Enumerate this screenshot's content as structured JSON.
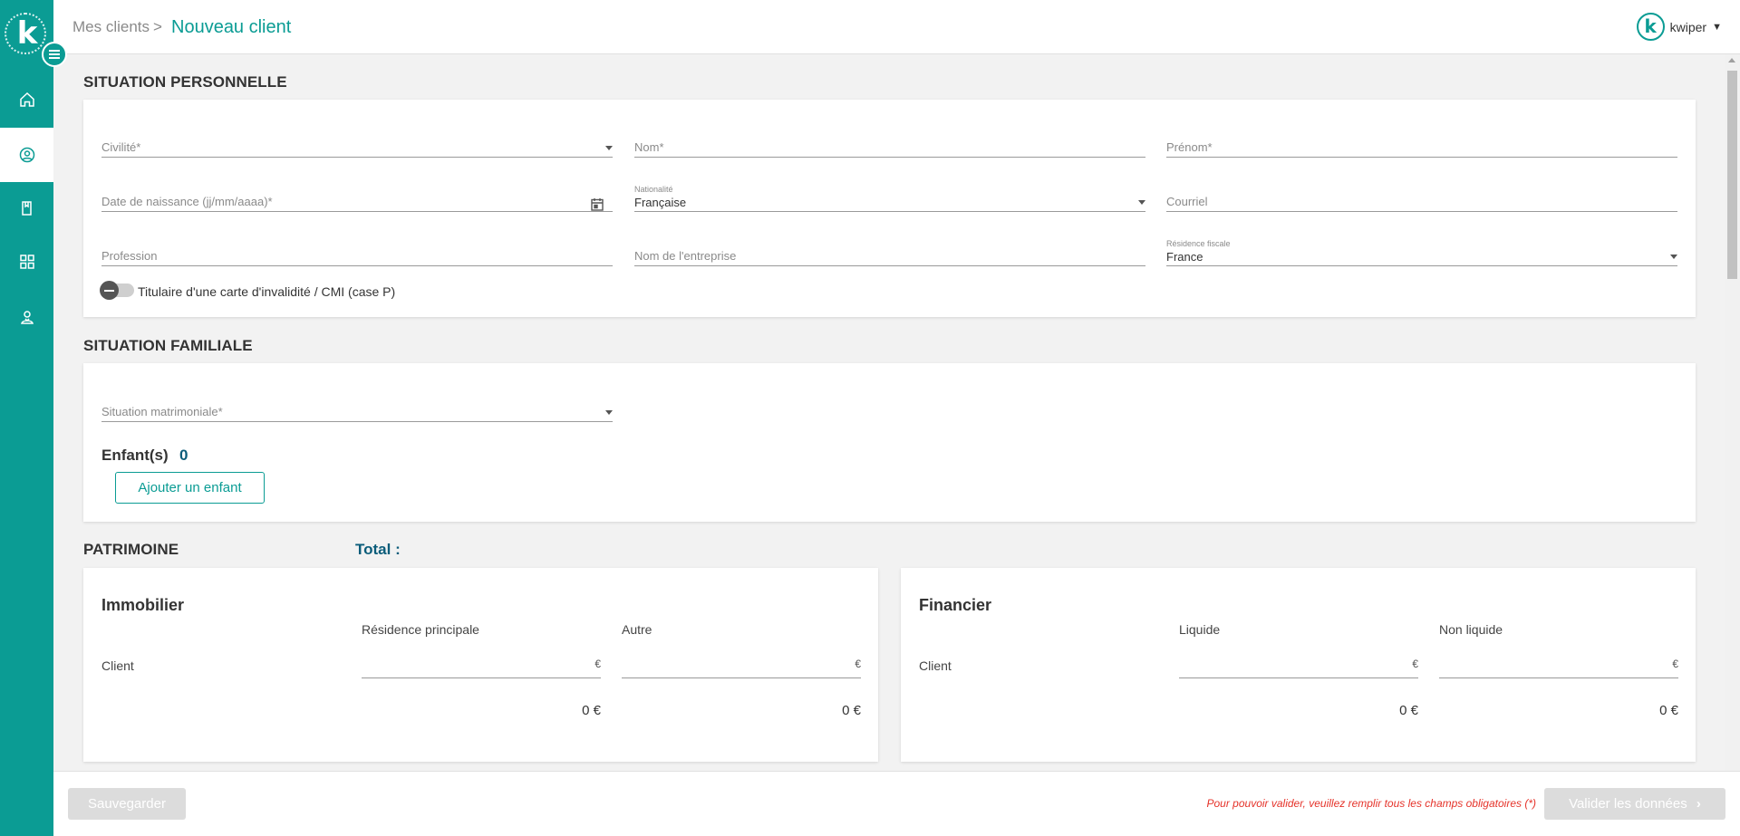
{
  "app": {
    "logo_letter": "k",
    "accent_color": "#0b9c94",
    "nav_icons": [
      "home-icon",
      "user-circle-icon",
      "document-icon",
      "grid-icon",
      "advisor-icon"
    ]
  },
  "header": {
    "breadcrumb_parent": "Mes clients",
    "breadcrumb_sep": ">",
    "title": "Nouveau client",
    "user_initial": "k",
    "user_name": "kwiper"
  },
  "personal": {
    "title": "SITUATION PERSONNELLE",
    "civilite": "Civilité*",
    "nom": "Nom*",
    "prenom": "Prénom*",
    "naissance": "Date de naissance (jj/mm/aaaa)*",
    "nationalite_label": "Nationalité",
    "nationalite_value": "Française",
    "courriel": "Courriel",
    "profession": "Profession",
    "entreprise": "Nom de l'entreprise",
    "residence_label": "Résidence fiscale",
    "residence_value": "France",
    "toggle_label": "Titulaire d'une carte d'invalidité / CMI (case P)"
  },
  "family": {
    "title": "SITUATION FAMILIALE",
    "matrimoniale": "Situation matrimoniale*",
    "children_label": "Enfant(s)",
    "children_count": "0",
    "add_child": "Ajouter un enfant"
  },
  "patrimoine": {
    "title": "PATRIMOINE",
    "total_label": "Total :",
    "immobilier": {
      "title": "Immobilier",
      "col1": "Résidence principale",
      "col2": "Autre",
      "row": "Client",
      "unit": "€",
      "sum1": "0 €",
      "sum2": "0 €"
    },
    "financier": {
      "title": "Financier",
      "col1": "Liquide",
      "col2": "Non liquide",
      "row": "Client",
      "unit": "€",
      "sum1": "0 €",
      "sum2": "0 €"
    }
  },
  "footer": {
    "save": "Sauvegarder",
    "warning": "Pour pouvoir valider, veuillez remplir tous les champs obligatoires (*)",
    "validate": "Valider les données"
  }
}
